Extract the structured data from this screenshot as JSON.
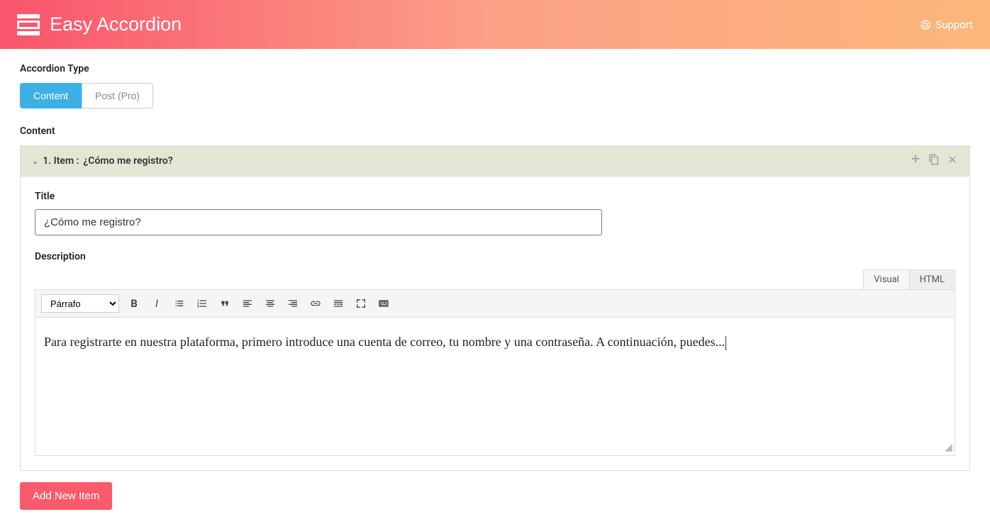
{
  "header": {
    "title": "Easy Accordion",
    "support_label": "Support"
  },
  "sections": {
    "accordion_type_label": "Accordion Type",
    "content_label": "Content"
  },
  "type_buttons": {
    "content": "Content",
    "post_pro": "Post (Pro)"
  },
  "item": {
    "header_prefix": "1. Item : ",
    "header_title": "¿Cómo me registro?",
    "title_label": "Title",
    "title_value": "¿Cómo me registro?",
    "description_label": "Description"
  },
  "editor": {
    "tab_visual": "Visual",
    "tab_html": "HTML",
    "format_option": "Párrafo",
    "content": "Para registrarte en nuestra plataforma, primero introduce una cuenta de correo, tu nombre y una contraseña. A continuación, puedes..."
  },
  "buttons": {
    "add_new_item": "Add New Item"
  }
}
